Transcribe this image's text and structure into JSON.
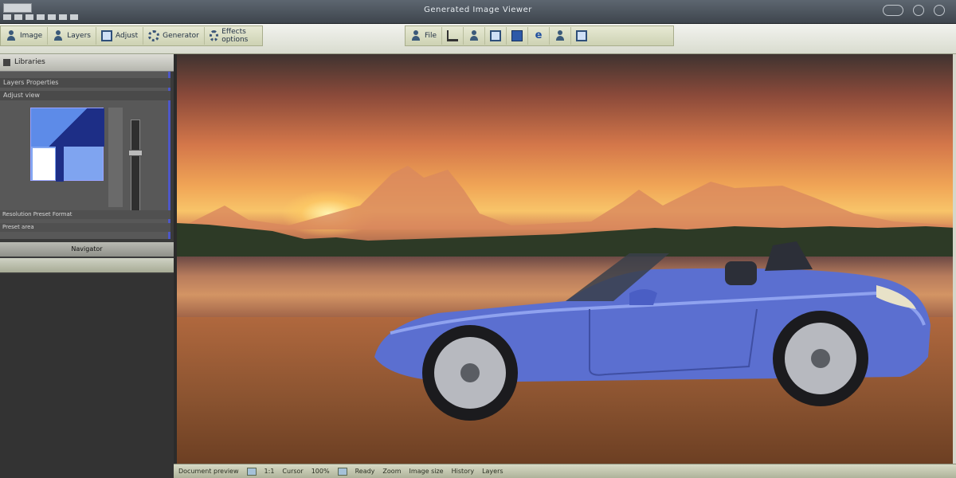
{
  "window": {
    "title": "Generated Image Viewer"
  },
  "toolbar": {
    "left_groups": [
      {
        "label": "Image",
        "icon": "user-icon"
      },
      {
        "label": "Layers",
        "icon": "user-icon"
      },
      {
        "label": "Adjust",
        "icon": "monitor-icon"
      },
      {
        "label": "Generator",
        "icon": "gear-icon"
      },
      {
        "label": "Effects options",
        "icon": "gear-icon"
      }
    ],
    "right_groups": [
      {
        "label": "File",
        "icon": "user-icon"
      },
      {
        "label": "",
        "icon": "cart-icon"
      },
      {
        "label": "",
        "icon": "user-icon"
      },
      {
        "label": "",
        "icon": "monitor-icon"
      },
      {
        "label": "",
        "icon": "square-icon"
      },
      {
        "label": "",
        "icon": "e-icon"
      },
      {
        "label": "",
        "icon": "user-icon"
      },
      {
        "label": "",
        "icon": "monitor-icon"
      }
    ]
  },
  "left_panel": {
    "header": "Libraries",
    "rows": [
      "Layers Properties",
      "Adjust view"
    ],
    "slider_value": 0.65,
    "bottom_rows": [
      "Resolution  Preset  Format",
      "Preset area"
    ],
    "sub_header": "Navigator"
  },
  "status_bar": {
    "items": [
      "Document preview",
      "1:1",
      "Cursor",
      "100%",
      "Ready",
      "Zoom",
      "Image size",
      "History",
      "Layers"
    ]
  },
  "colors": {
    "accent": "#4d57c8",
    "car_body": "#5b6fd0",
    "sky_top": "#3f3330",
    "sky_glow": "#f8c469"
  }
}
